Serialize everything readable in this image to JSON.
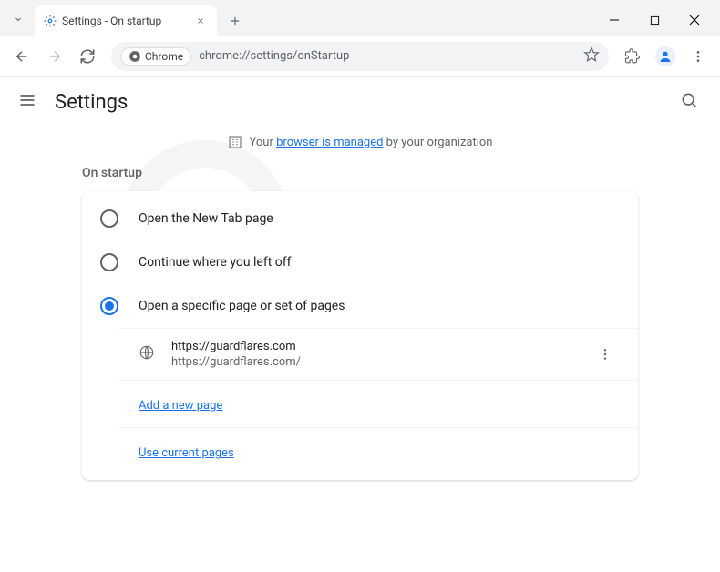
{
  "window": {
    "tab_title": "Settings - On startup",
    "new_tab_tooltip": "+"
  },
  "toolbar": {
    "chrome_chip": "Chrome",
    "url": "chrome://settings/onStartup"
  },
  "header": {
    "title": "Settings"
  },
  "managed": {
    "prefix": "Your ",
    "link": "browser is managed",
    "suffix": " by your organization"
  },
  "section": {
    "label": "On startup",
    "options": [
      {
        "label": "Open the New Tab page",
        "selected": false
      },
      {
        "label": "Continue where you left off",
        "selected": false
      },
      {
        "label": "Open a specific page or set of pages",
        "selected": true
      }
    ],
    "pages": [
      {
        "title": "https://guardflares.com",
        "url": "https://guardflares.com/"
      }
    ],
    "add_page": "Add a new page",
    "use_current": "Use current pages"
  }
}
